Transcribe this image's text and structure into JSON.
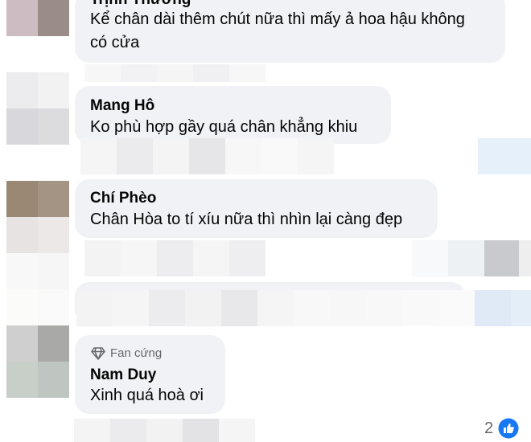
{
  "comments": [
    {
      "author": "Trịnh Thương",
      "text_line1": "Kể chân dài thêm chút nữa thì mấy ả hoa hậu không",
      "text_line2": "có cửa"
    },
    {
      "author": "Mang Hô",
      "text": "Ko phù hợp gầy quá chân khẳng khiu"
    },
    {
      "author": "Chí Phèo",
      "text": "Chân Hòa to tí xíu nữa thì nhìn lại càng đẹp"
    },
    {
      "badge": "Fan cứng",
      "author": "Nam Duy",
      "text": "Xinh quá hoà ơi"
    }
  ],
  "reactions": {
    "count": "2",
    "icon": "like-icon",
    "color": "#1877f2"
  },
  "colors": {
    "bubble": "#f0f2f5",
    "text": "#050505",
    "secondary": "#65676b"
  }
}
